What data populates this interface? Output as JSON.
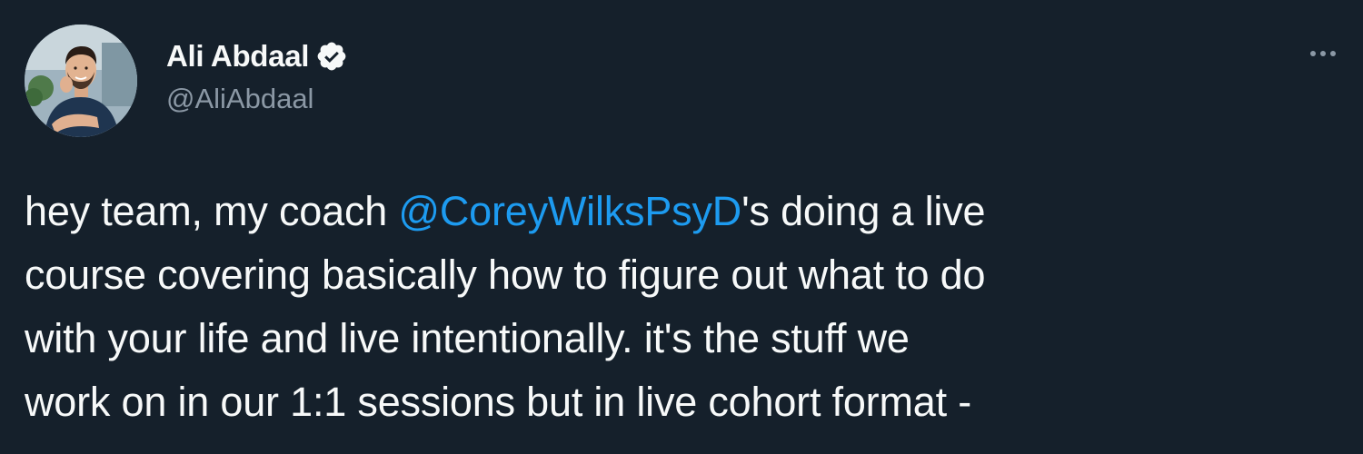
{
  "author": {
    "display_name": "Ali Abdaal",
    "handle": "@AliAbdaal",
    "verified": true,
    "avatar_icon": "avatar-photo"
  },
  "menu": {
    "icon": "more-options-icon"
  },
  "tweet": {
    "line1_before": "hey team, my coach ",
    "mention": "@CoreyWilksPsyD",
    "line1_after": "'s doing a live",
    "line2": "course covering basically how to figure out what to do",
    "line3": "with your life and live intentionally. it's the stuff we",
    "line4": "work on in our 1:1 sessions but in live cohort format -"
  },
  "colors": {
    "background": "#15202b",
    "text": "#f7f9f9",
    "secondary_text": "#8b98a5",
    "link": "#1d9bf0"
  }
}
